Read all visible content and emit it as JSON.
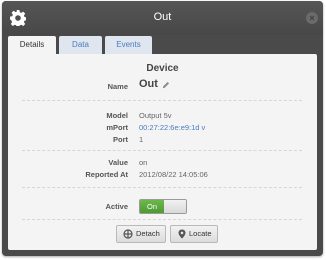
{
  "window": {
    "title": "Out"
  },
  "tabs": [
    {
      "label": "Details"
    },
    {
      "label": "Data"
    },
    {
      "label": "Events"
    }
  ],
  "device": {
    "heading": "Device",
    "name_label": "Name",
    "name_value": "Out",
    "model_label": "Model",
    "model_value": "Output 5v",
    "mport_label": "mPort",
    "mport_value": "00:27:22:6e:e9:1d v",
    "port_label": "Port",
    "port_value": "1",
    "value_label": "Value",
    "value_value": "on",
    "reported_label": "Reported At",
    "reported_value": "2012/08/22 14:05:06",
    "active_label": "Active",
    "active_toggle_text": "On"
  },
  "buttons": {
    "detach": "Detach",
    "locate": "Locate"
  },
  "icons": [
    "gear-icon",
    "close-icon",
    "pencil-icon",
    "detach-icon",
    "locate-icon"
  ],
  "colors": {
    "titlebar": "#4a4a4a",
    "tab_link": "#4a7cc0",
    "toggle_on": "#5aa83d"
  }
}
